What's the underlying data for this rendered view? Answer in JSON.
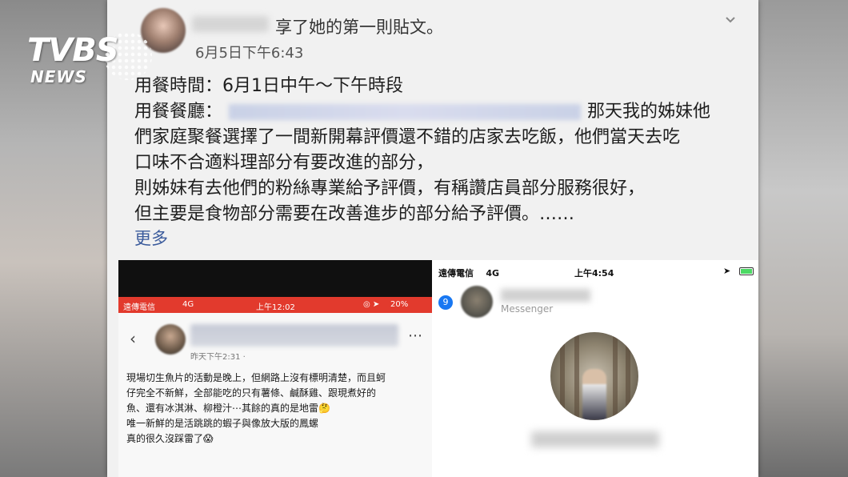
{
  "brand": {
    "logo_main": "TVBS",
    "logo_sub": "NEWS"
  },
  "post": {
    "header_action": "享了她的第一則貼文。",
    "date": "6月5日下午6:43",
    "lines": {
      "l1": "用餐時間：6月1日中午～下午時段",
      "l2_label": "用餐餐廳：",
      "l2_tail": "那天我的姊妹他",
      "l3": "們家庭聚餐選擇了一間新開幕評價還不錯的店家去吃飯，他們當天去吃",
      "l4": "口味不合適料理部分有要改進的部分，",
      "l5": "則姊妹有去他們的粉絲專業給予評價，有稱讚店員部分服務很好，",
      "l6": "但主要是食物部分需要在改善進步的部分給予評價。……"
    },
    "more_label": "更多"
  },
  "left_screenshot": {
    "status_carrier": "遠傳電信",
    "status_network": "4G",
    "status_time": "上午12:02",
    "status_battery": "20%",
    "post_time": "昨天下午2:31 ·",
    "more_icon": "⋯",
    "body_lines": [
      "現場切生魚片的活動是晚上，但網路上沒有標明清楚，而且蚵",
      "仔完全不新鮮，全部能吃的只有薯條、鹹酥雞、跟現煮好的",
      "魚、還有冰淇淋、柳橙汁⋯其餘的真的是地雷🤔",
      "唯一新鮮的是活跳跳的蝦子與像放大版的鳳螺",
      "真的很久沒踩雷了😱"
    ]
  },
  "right_screenshot": {
    "status_carrier": "遠傳電信",
    "status_network": "4G",
    "status_time": "上午4:54",
    "status_location": "➤",
    "battery_level": 1.0,
    "badge_count": "9",
    "service_label": "Messenger"
  },
  "colors": {
    "facebook_link": "#3b5b9c",
    "status_red": "#e23a2d",
    "messenger_blue": "#1877f2",
    "battery_green": "#4cd964"
  }
}
